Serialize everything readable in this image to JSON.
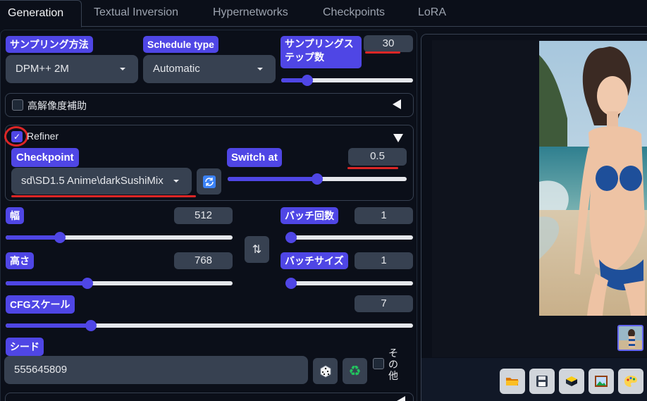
{
  "tabs": [
    {
      "label": "Generation",
      "active": true
    },
    {
      "label": "Textual Inversion",
      "active": false
    },
    {
      "label": "Hypernetworks",
      "active": false
    },
    {
      "label": "Checkpoints",
      "active": false
    },
    {
      "label": "LoRA",
      "active": false
    }
  ],
  "sampling": {
    "method_label": "サンプリング方法",
    "method_value": "DPM++ 2M",
    "schedule_label": "Schedule type",
    "schedule_value": "Automatic",
    "steps_label": "サンプリングステップ数",
    "steps_value": "30",
    "steps_fraction": 0.2
  },
  "hires": {
    "label": "高解像度補助",
    "checked": false
  },
  "refiner": {
    "label": "Refiner",
    "checked": true,
    "checkpoint_label": "Checkpoint",
    "checkpoint_value": "sd\\SD1.5 Anime\\darkSushiMix",
    "switch_label": "Switch at",
    "switch_value": "0.5",
    "switch_fraction": 0.5
  },
  "size": {
    "width_label": "幅",
    "width_value": "512",
    "width_fraction": 0.24,
    "height_label": "高さ",
    "height_value": "768",
    "height_fraction": 0.36
  },
  "batch": {
    "count_label": "バッチ回数",
    "count_value": "1",
    "count_fraction": 0,
    "size_label": "バッチサイズ",
    "size_value": "1",
    "size_fraction": 0
  },
  "cfg": {
    "label": "CFGスケール",
    "value": "7",
    "fraction": 0.21
  },
  "seed": {
    "label": "シード",
    "value": "555645809",
    "extra_label": "その他"
  },
  "icons": {
    "refresh": "refresh-icon",
    "swap": "swap-icon",
    "dice": "dice-icon",
    "recycle": "recycle-icon",
    "folder": "folder-icon",
    "save": "save-icon",
    "zip": "zip-icon",
    "image": "image-icon",
    "palette": "palette-icon"
  },
  "colors": {
    "accent": "#4f46e5",
    "background": "#0b0f19",
    "field": "#374151",
    "annotation": "#dc2626"
  }
}
